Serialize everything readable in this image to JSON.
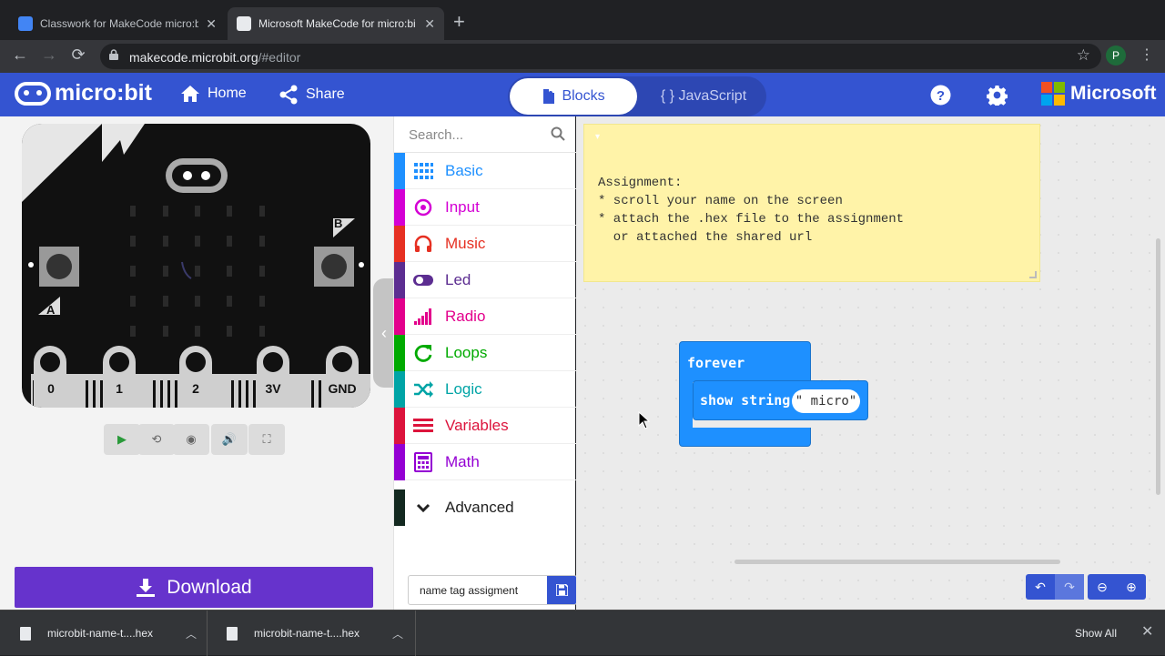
{
  "browser": {
    "tabs": [
      {
        "title": "Classwork for MakeCode micro:b",
        "close": "✕",
        "favicon_color": "#4285f4"
      },
      {
        "title": "Microsoft MakeCode for micro:bi",
        "close": "✕",
        "favicon_color": "#e8eaed"
      }
    ],
    "new_tab": "+",
    "url_host": "makecode.microbit.org",
    "url_path": "/#editor",
    "profile_initial": "P"
  },
  "header": {
    "logo_text": "micro:bit",
    "home_label": "Home",
    "share_label": "Share",
    "blocks_label": "Blocks",
    "javascript_label": "{ } JavaScript",
    "microsoft_label": "Microsoft"
  },
  "simulator": {
    "button_a": "A",
    "button_b": "B",
    "pins": [
      "0",
      "1",
      "2",
      "3V",
      "GND"
    ],
    "controls": [
      "play-icon",
      "restart-icon",
      "slowmo-icon",
      "sound-icon",
      "fullscreen-icon"
    ]
  },
  "download_label": "Download",
  "toolbox": {
    "search_placeholder": "Search...",
    "categories": [
      {
        "label": "Basic",
        "color": "#1e90ff"
      },
      {
        "label": "Input",
        "color": "#d400d4"
      },
      {
        "label": "Music",
        "color": "#e63022"
      },
      {
        "label": "Led",
        "color": "#5c2d91"
      },
      {
        "label": "Radio",
        "color": "#e3008c"
      },
      {
        "label": "Loops",
        "color": "#00aa00"
      },
      {
        "label": "Logic",
        "color": "#00a4a6"
      },
      {
        "label": "Variables",
        "color": "#dc143c"
      },
      {
        "label": "Math",
        "color": "#9400d3"
      }
    ],
    "advanced_label": "Advanced"
  },
  "project_name": "name tag assigment",
  "workspace": {
    "comment_text": "Assignment:\n* scroll your name on the screen\n* attach the .hex file to the assignment\n  or attached the shared url",
    "forever_label": "forever",
    "show_string_label": "show string",
    "string_value": "\" micro\""
  },
  "downloads": {
    "items": [
      "microbit-name-t....hex",
      "microbit-name-t....hex"
    ],
    "show_all": "Show All",
    "close": "✕"
  }
}
